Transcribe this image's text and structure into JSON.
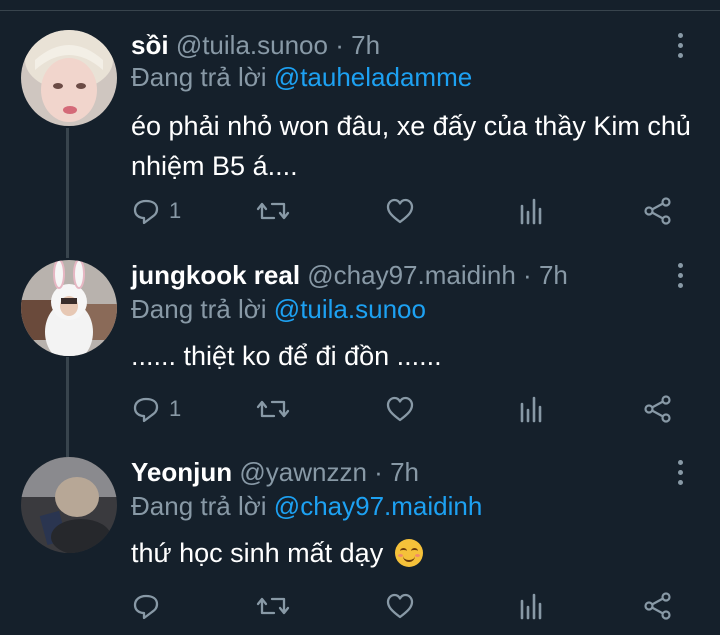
{
  "colors": {
    "background": "#15202b",
    "muted": "#8899a6",
    "accent": "#1da1f2",
    "divider": "#38444d"
  },
  "reply_prefix": "Đang trả lời",
  "tweets": [
    {
      "name": "sồi",
      "handle": "@tuila.sunoo",
      "dot": "·",
      "time": "7h",
      "reply_to": "@tauheladamme",
      "text": "éo phải nhỏ won đâu, xe đấy của thầy Kim chủ nhiệm B5 á....",
      "reply_count": "1",
      "avatar": "avatar-pale-hair-photo"
    },
    {
      "name": "jungkook real",
      "handle": "@chay97.maidinh",
      "dot": "·",
      "time": "7h",
      "reply_to": "@tuila.sunoo",
      "text": "...... thiệt ko để đi đồn ......",
      "reply_count": "1",
      "avatar": "avatar-bunny-costume-photo"
    },
    {
      "name": "Yeonjun",
      "handle": "@yawnzzn",
      "dot": "·",
      "time": "7h",
      "reply_to": "@chay97.maidinh",
      "text": "thứ học sinh mất dạy",
      "text_emoji": "smiling-face-emoji",
      "reply_count": "",
      "avatar": "avatar-dark-photo"
    }
  ],
  "icons": [
    "reply-icon",
    "retweet-icon",
    "like-icon",
    "analytics-icon",
    "share-icon",
    "more-options-icon"
  ]
}
